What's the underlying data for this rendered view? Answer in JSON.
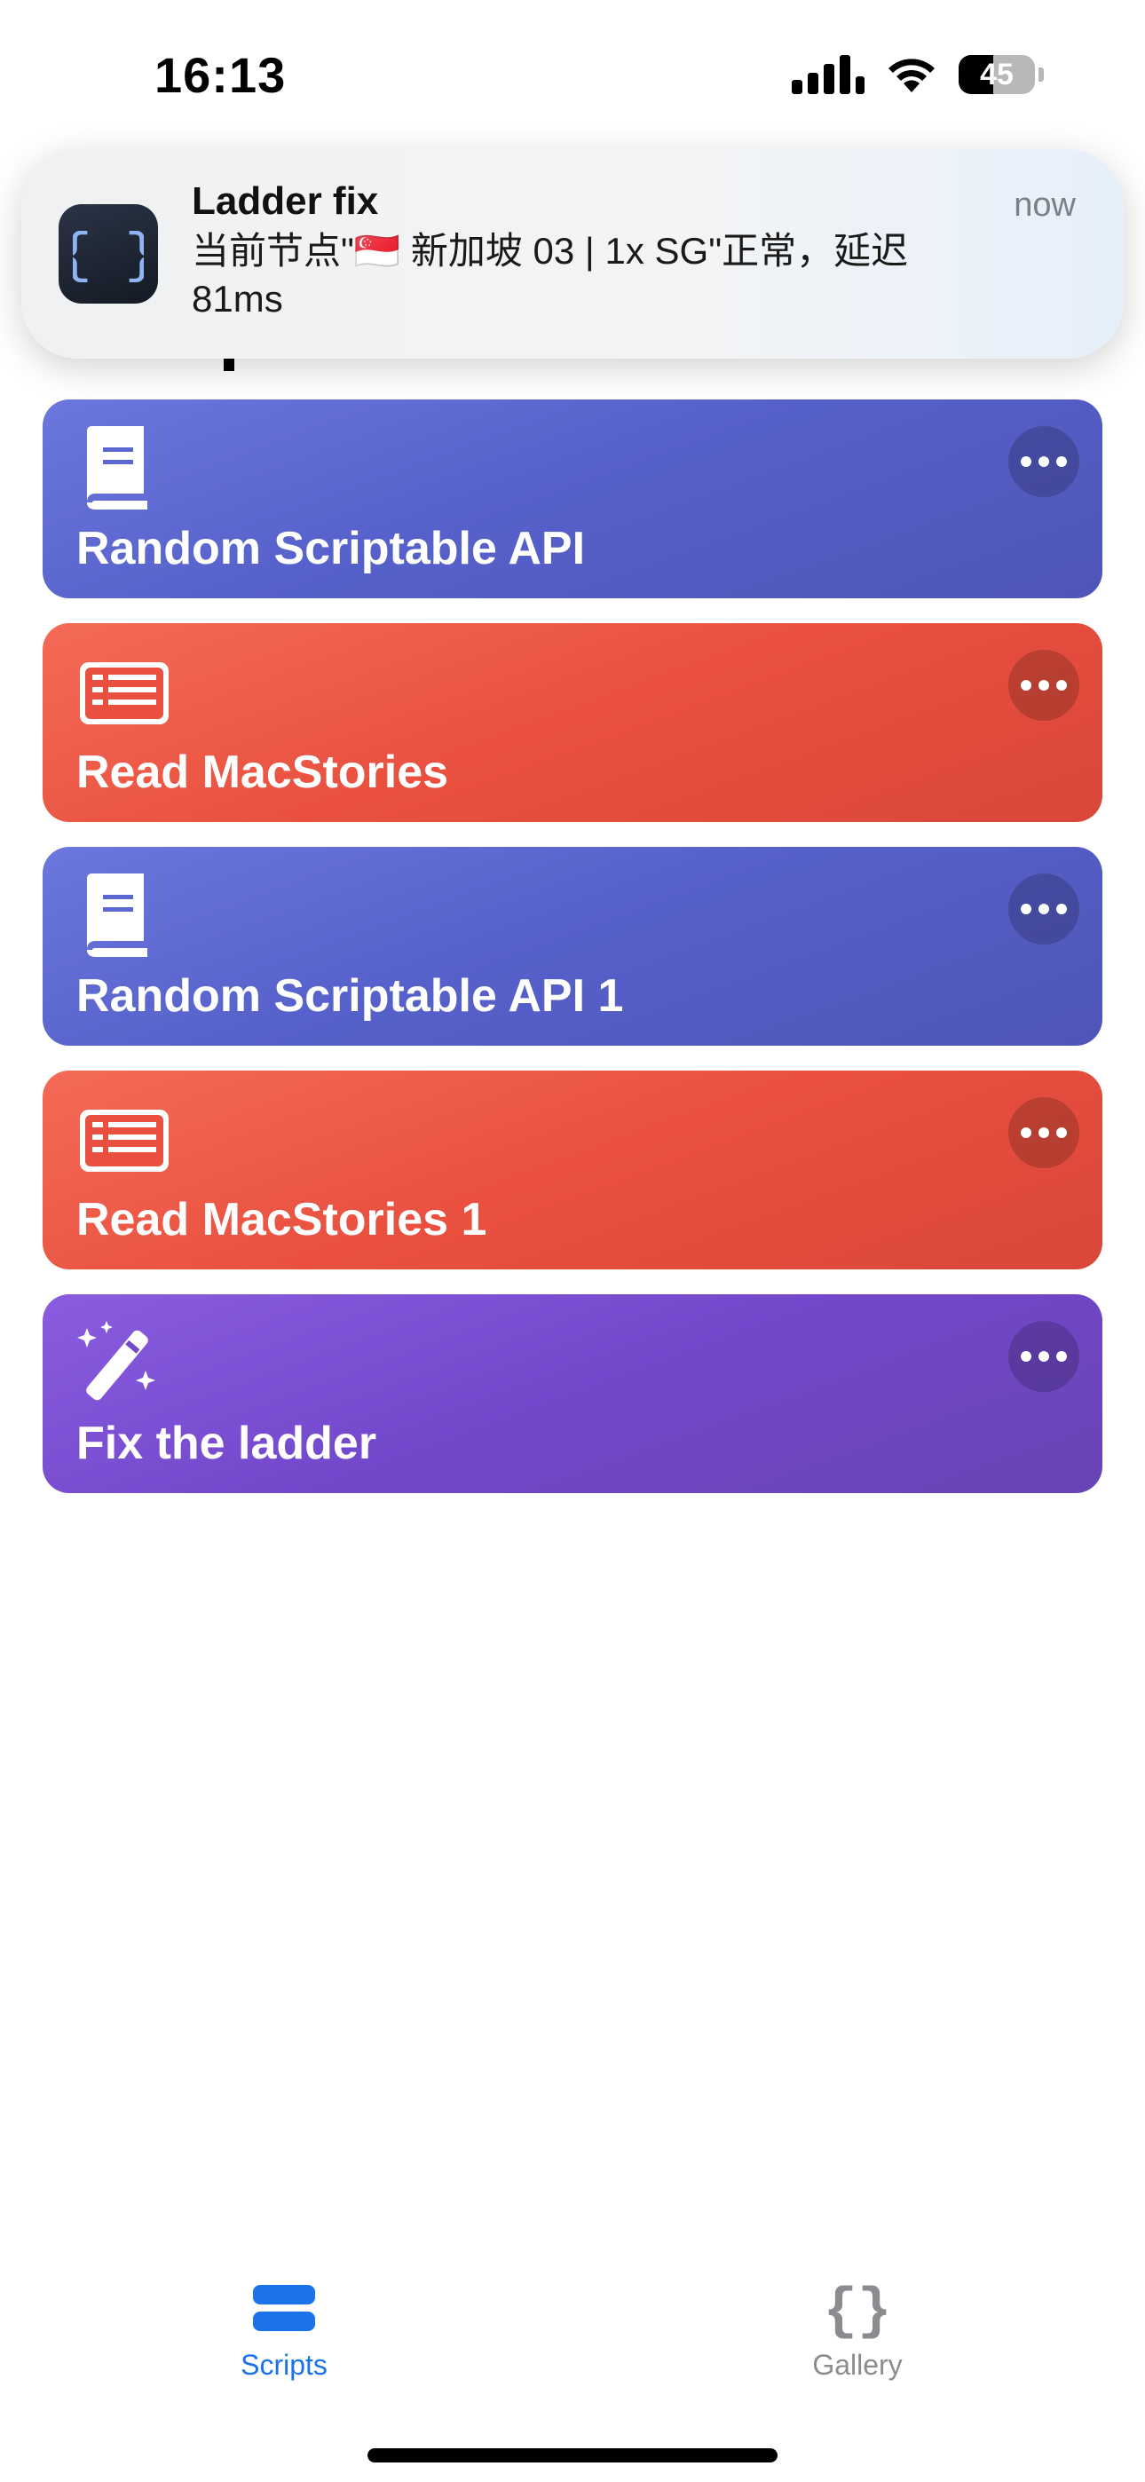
{
  "status_bar": {
    "time": "16:13",
    "battery_text": "45",
    "battery_level_percent": 45
  },
  "notification": {
    "app_name": "Ladder fix",
    "body": "当前节点\"🇸🇬 新加坡 03 | 1x SG\"正常，延迟 81ms",
    "time": "now",
    "app_icon": "curly-braces-icon"
  },
  "scripts": [
    {
      "label": "Random Scriptable API",
      "icon": "book-icon",
      "color": "#5761cb"
    },
    {
      "label": "Read MacStories",
      "icon": "newspaper-icon",
      "color": "#e9503f"
    },
    {
      "label": "Random Scriptable API 1",
      "icon": "book-icon",
      "color": "#5761cb"
    },
    {
      "label": "Read MacStories 1",
      "icon": "newspaper-icon",
      "color": "#e9503f"
    },
    {
      "label": "Fix the ladder",
      "icon": "magic-wand-icon",
      "color": "#7248cb"
    }
  ],
  "tab_bar": {
    "tabs": [
      {
        "label": "Scripts",
        "icon": "scripts-list-icon",
        "active": true,
        "color": "#1a73e8"
      },
      {
        "label": "Gallery",
        "icon": "curly-braces-icon",
        "active": false,
        "color": "#8c8c90"
      }
    ]
  }
}
